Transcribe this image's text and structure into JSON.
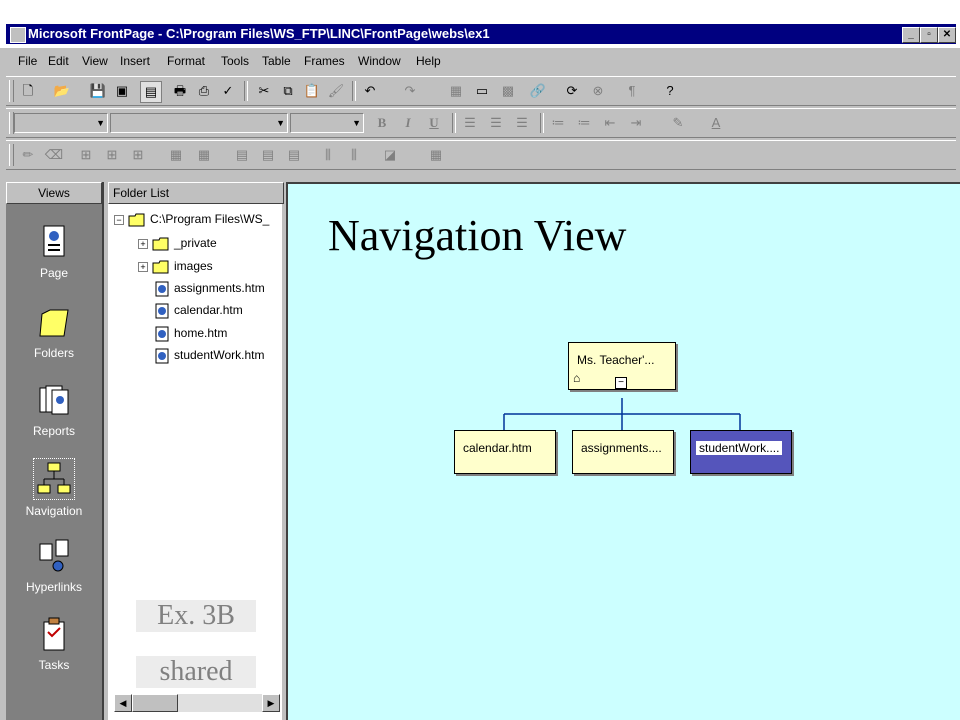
{
  "window": {
    "title": "Microsoft FrontPage - C:\\Program Files\\WS_FTP\\LINC\\FrontPage\\webs\\ex1",
    "controls": [
      "_",
      "▫",
      "✕"
    ]
  },
  "menu": [
    "File",
    "Edit",
    "View",
    "Insert",
    "Format",
    "Tools",
    "Table",
    "Frames",
    "Window",
    "Help"
  ],
  "format_toolbar": {
    "bold": "B",
    "italic": "I",
    "underline": "U"
  },
  "views": {
    "header": "Views",
    "items": [
      {
        "label": "Page",
        "icon": "page-icon"
      },
      {
        "label": "Folders",
        "icon": "folders-icon"
      },
      {
        "label": "Reports",
        "icon": "reports-icon"
      },
      {
        "label": "Navigation",
        "icon": "navigation-icon",
        "selected": true
      },
      {
        "label": "Hyperlinks",
        "icon": "hyperlinks-icon"
      },
      {
        "label": "Tasks",
        "icon": "tasks-icon"
      }
    ]
  },
  "folder_list": {
    "header": "Folder List",
    "root": "C:\\Program Files\\WS_",
    "folders": [
      "_private",
      "images"
    ],
    "files": [
      "assignments.htm",
      "calendar.htm",
      "home.htm",
      "studentWork.htm"
    ]
  },
  "navigation": {
    "heading": "Navigation View",
    "root_page": "Ms. Teacher'...",
    "child_pages": [
      "calendar.htm",
      "assignments....",
      "studentWork...."
    ],
    "collapse_symbol": "−"
  },
  "overlays": {
    "example": "Ex. 3B",
    "shared": "shared"
  },
  "colors": {
    "title_bar": "#000080",
    "nav_background": "#ccffff",
    "page_box": "#ffffcc",
    "selected_page": "#5555bb"
  }
}
